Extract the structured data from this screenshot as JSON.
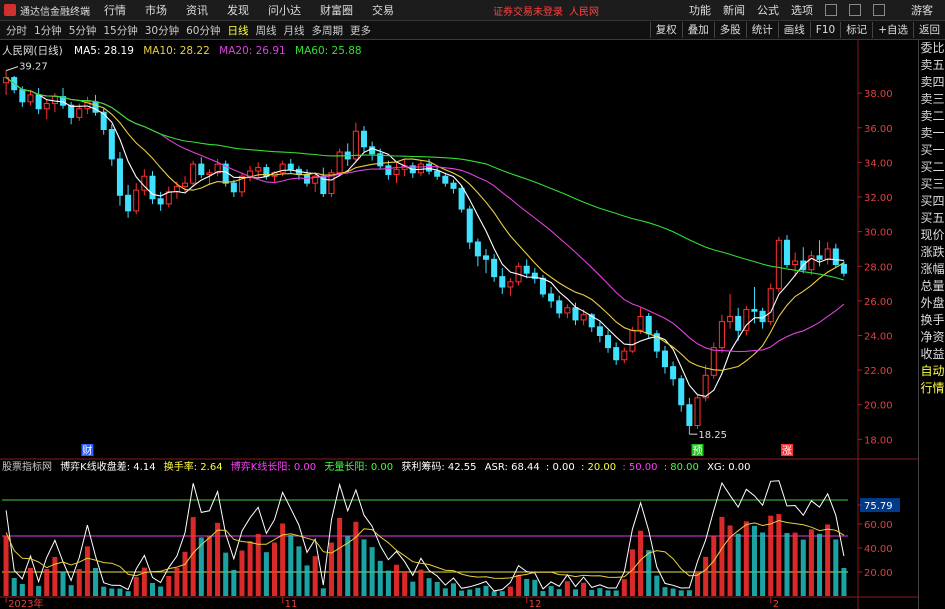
{
  "window": {
    "app_title": "通达信金融终端",
    "menu": [
      "行情",
      "市场",
      "资讯",
      "发现",
      "问小达",
      "财富圈",
      "交易"
    ],
    "notice": "证券交易未登录",
    "notice_stock": "人民网",
    "right_menu": [
      "功能",
      "新闻",
      "公式",
      "选项"
    ],
    "guest": "游客"
  },
  "toolbar": {
    "periods": [
      "分时",
      "1分钟",
      "5分钟",
      "15分钟",
      "30分钟",
      "60分钟",
      "日线",
      "周线",
      "月线",
      "多周期",
      "更多"
    ],
    "active_period": "日线",
    "funcs": [
      "复权",
      "叠加",
      "多股",
      "统计",
      "画线",
      "F10",
      "标记",
      "+自选",
      "返回"
    ]
  },
  "side_panel": [
    "委比",
    "卖五",
    "卖四",
    "卖三",
    "卖二",
    "卖一",
    "买一",
    "买二",
    "买三",
    "买四",
    "买五",
    "现价",
    "涨跌",
    "涨幅",
    "总量",
    "外盘",
    "换手",
    "净资",
    "收益",
    "自动",
    "行情"
  ],
  "main_legend": {
    "stock": "人民网(日线)",
    "items": [
      {
        "label": "MA5: 28.19",
        "color": "#ffffff"
      },
      {
        "label": "MA10: 28.22",
        "color": "#e8d040"
      },
      {
        "label": "MA20: 26.91",
        "color": "#e040e0"
      },
      {
        "label": "MA60: 25.88",
        "color": "#30e030"
      }
    ]
  },
  "sub_legend": {
    "items": [
      {
        "label": "股票指标网",
        "color": "#c8c8c8"
      },
      {
        "label": "博弈K线收盘差: 4.14",
        "color": "#ffffff"
      },
      {
        "label": "换手率: 2.64",
        "color": "#ffff40"
      },
      {
        "label": "博弈K线长阳: 0.00",
        "color": "#ff40ff"
      },
      {
        "label": "无量长阳: 0.00",
        "color": "#40ff40"
      },
      {
        "label": "获利筹码: 42.55",
        "color": "#ffffff"
      },
      {
        "label": "ASR: 68.44",
        "color": "#ffffff"
      },
      {
        "label": ": 0.00",
        "color": "#ffffff"
      },
      {
        "label": ": 20.00",
        "color": "#ffff40"
      },
      {
        "label": ": 50.00",
        "color": "#ff40ff"
      },
      {
        "label": ": 80.00",
        "color": "#40ff40"
      },
      {
        "label": "XG: 0.00",
        "color": "#ffffff"
      }
    ]
  },
  "chart_data": {
    "type": "candlestick",
    "main_y_ticks": [
      38.0,
      36.0,
      34.0,
      32.0,
      30.0,
      28.0,
      26.0,
      24.0,
      22.0,
      20.0,
      18.0
    ],
    "main_ylim": [
      17.5,
      39.8
    ],
    "high_label": "39.27",
    "low_label": "18.25",
    "event_marks": [
      "财",
      "预",
      "涨"
    ],
    "sub_y_ticks": [
      75.79,
      60.0,
      40.0,
      20.0
    ],
    "sub_ylim": [
      0,
      100
    ],
    "sub_ref_lines": [
      {
        "value": 80,
        "color": "#40d040"
      },
      {
        "value": 50,
        "color": "#e040e0"
      },
      {
        "value": 20,
        "color": "#e0e040"
      }
    ],
    "date_labels": [
      "2023年",
      "11",
      "12",
      "2"
    ],
    "ohlc": [
      [
        38.6,
        39.3,
        37.9,
        38.9
      ],
      [
        38.9,
        39.0,
        38.0,
        38.2
      ],
      [
        38.2,
        38.4,
        37.2,
        37.5
      ],
      [
        37.5,
        38.2,
        37.3,
        37.9
      ],
      [
        37.9,
        38.3,
        36.8,
        37.1
      ],
      [
        37.1,
        37.6,
        36.5,
        37.4
      ],
      [
        37.4,
        38.0,
        36.9,
        37.8
      ],
      [
        37.8,
        38.3,
        37.1,
        37.3
      ],
      [
        37.3,
        37.5,
        36.2,
        36.6
      ],
      [
        36.6,
        37.4,
        36.4,
        37.1
      ],
      [
        37.1,
        37.8,
        36.8,
        37.5
      ],
      [
        37.5,
        37.9,
        36.7,
        36.9
      ],
      [
        36.9,
        37.1,
        35.6,
        35.9
      ],
      [
        35.9,
        36.2,
        33.8,
        34.2
      ],
      [
        34.2,
        34.6,
        31.5,
        32.1
      ],
      [
        32.1,
        32.7,
        30.8,
        31.2
      ],
      [
        31.2,
        32.8,
        31.0,
        32.4
      ],
      [
        32.4,
        33.6,
        32.1,
        33.2
      ],
      [
        33.2,
        33.5,
        31.6,
        31.9
      ],
      [
        31.9,
        32.3,
        31.2,
        31.6
      ],
      [
        31.6,
        32.6,
        31.4,
        32.3
      ],
      [
        32.3,
        32.9,
        31.9,
        32.6
      ],
      [
        32.6,
        33.2,
        32.3,
        32.8
      ],
      [
        32.8,
        34.1,
        32.6,
        33.9
      ],
      [
        33.9,
        34.3,
        33.1,
        33.3
      ],
      [
        33.3,
        33.6,
        32.7,
        33.4
      ],
      [
        33.4,
        34.2,
        33.2,
        33.9
      ],
      [
        33.9,
        34.1,
        32.6,
        32.8
      ],
      [
        32.8,
        33.0,
        32.0,
        32.3
      ],
      [
        32.3,
        33.4,
        32.0,
        33.2
      ],
      [
        33.2,
        33.8,
        32.9,
        33.5
      ],
      [
        33.5,
        34.0,
        33.1,
        33.7
      ],
      [
        33.7,
        33.9,
        33.0,
        33.2
      ],
      [
        33.2,
        33.5,
        32.8,
        33.4
      ],
      [
        33.4,
        34.1,
        33.2,
        33.9
      ],
      [
        33.9,
        34.2,
        33.4,
        33.6
      ],
      [
        33.6,
        33.8,
        33.0,
        33.3
      ],
      [
        33.3,
        33.6,
        32.6,
        32.8
      ],
      [
        32.8,
        33.4,
        32.3,
        33.2
      ],
      [
        33.2,
        33.7,
        32.0,
        32.2
      ],
      [
        32.2,
        33.6,
        32.0,
        33.4
      ],
      [
        33.4,
        34.8,
        33.2,
        34.6
      ],
      [
        34.6,
        35.1,
        33.8,
        34.2
      ],
      [
        34.2,
        36.3,
        34.0,
        35.8
      ],
      [
        35.8,
        36.1,
        34.6,
        34.9
      ],
      [
        34.9,
        35.2,
        34.1,
        34.5
      ],
      [
        34.5,
        34.8,
        33.6,
        33.8
      ],
      [
        33.8,
        34.1,
        33.0,
        33.3
      ],
      [
        33.3,
        34.0,
        32.8,
        33.6
      ],
      [
        33.6,
        34.2,
        33.2,
        33.8
      ],
      [
        33.8,
        34.0,
        33.1,
        33.4
      ],
      [
        33.4,
        34.1,
        33.2,
        33.9
      ],
      [
        33.9,
        34.2,
        33.3,
        33.5
      ],
      [
        33.5,
        33.8,
        33.0,
        33.2
      ],
      [
        33.2,
        33.4,
        32.6,
        32.8
      ],
      [
        32.8,
        33.0,
        32.2,
        32.5
      ],
      [
        32.5,
        32.7,
        31.1,
        31.3
      ],
      [
        31.3,
        31.5,
        29.0,
        29.4
      ],
      [
        29.4,
        29.6,
        28.0,
        28.6
      ],
      [
        28.6,
        29.0,
        27.6,
        28.4
      ],
      [
        28.4,
        28.7,
        27.1,
        27.4
      ],
      [
        27.4,
        27.9,
        26.4,
        26.8
      ],
      [
        26.8,
        27.3,
        26.3,
        27.1
      ],
      [
        27.1,
        28.2,
        26.9,
        28.0
      ],
      [
        28.0,
        28.4,
        27.3,
        27.6
      ],
      [
        27.6,
        27.9,
        27.0,
        27.3
      ],
      [
        27.3,
        27.5,
        26.2,
        26.4
      ],
      [
        26.4,
        26.8,
        25.6,
        26.0
      ],
      [
        26.0,
        26.3,
        25.0,
        25.3
      ],
      [
        25.3,
        25.8,
        25.0,
        25.6
      ],
      [
        25.6,
        25.9,
        24.6,
        24.9
      ],
      [
        24.9,
        25.5,
        24.6,
        25.2
      ],
      [
        25.2,
        25.3,
        24.2,
        24.5
      ],
      [
        24.5,
        24.8,
        23.6,
        24.0
      ],
      [
        24.0,
        24.3,
        23.0,
        23.3
      ],
      [
        23.3,
        23.6,
        22.3,
        22.6
      ],
      [
        22.6,
        23.3,
        22.4,
        23.1
      ],
      [
        23.1,
        24.5,
        23.0,
        24.3
      ],
      [
        24.3,
        25.6,
        24.1,
        25.1
      ],
      [
        25.1,
        25.3,
        23.8,
        24.1
      ],
      [
        24.1,
        24.3,
        22.7,
        23.1
      ],
      [
        23.1,
        23.4,
        21.8,
        22.2
      ],
      [
        22.2,
        22.5,
        21.1,
        21.5
      ],
      [
        21.5,
        21.7,
        19.6,
        20.0
      ],
      [
        20.0,
        20.4,
        18.3,
        18.8
      ],
      [
        18.8,
        20.6,
        18.6,
        20.4
      ],
      [
        20.4,
        22.3,
        20.2,
        21.7
      ],
      [
        21.7,
        23.6,
        21.5,
        23.3
      ],
      [
        23.3,
        25.2,
        23.0,
        24.8
      ],
      [
        24.8,
        26.4,
        24.4,
        25.1
      ],
      [
        25.1,
        25.6,
        23.7,
        24.3
      ],
      [
        24.3,
        25.7,
        24.0,
        25.5
      ],
      [
        25.5,
        26.8,
        24.7,
        25.4
      ],
      [
        25.4,
        25.6,
        24.4,
        24.8
      ],
      [
        24.8,
        27.0,
        24.6,
        26.7
      ],
      [
        26.7,
        29.7,
        26.5,
        29.5
      ],
      [
        29.5,
        29.8,
        27.9,
        28.1
      ],
      [
        28.1,
        28.8,
        27.4,
        28.3
      ],
      [
        28.3,
        29.1,
        27.6,
        27.8
      ],
      [
        27.8,
        28.9,
        27.5,
        28.6
      ],
      [
        28.6,
        29.5,
        28.0,
        28.4
      ],
      [
        28.4,
        29.4,
        28.1,
        29.0
      ],
      [
        29.0,
        29.3,
        27.9,
        28.1
      ],
      [
        28.1,
        28.3,
        27.4,
        27.6
      ]
    ]
  }
}
